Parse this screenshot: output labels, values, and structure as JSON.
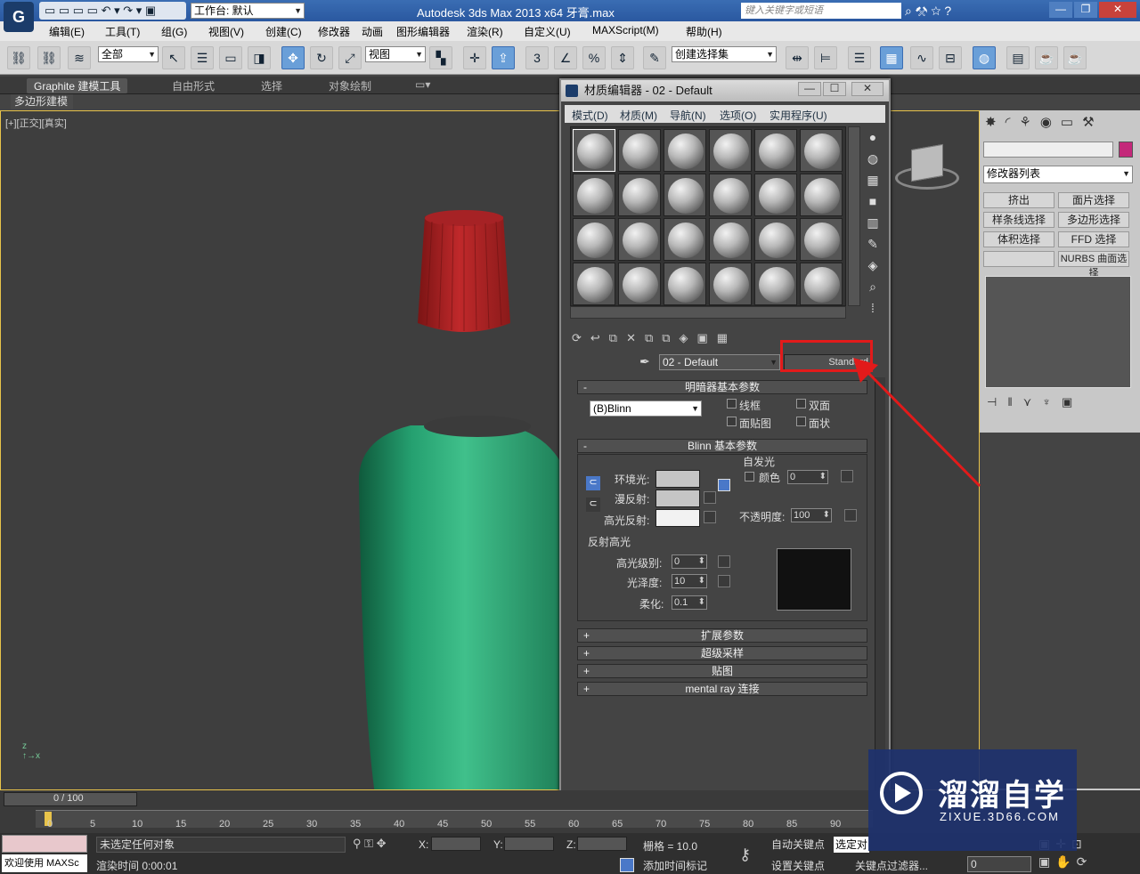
{
  "window": {
    "title": "Autodesk 3ds Max  2013 x64    牙膏.max",
    "workspace": "工作台: 默认",
    "search_placeholder": "键入关键字或短语"
  },
  "menu": [
    "编辑(E)",
    "工具(T)",
    "组(G)",
    "视图(V)",
    "创建(C)",
    "修改器",
    "动画",
    "图形编辑器",
    "渲染(R)",
    "自定义(U)",
    "MAXScript(M)",
    "帮助(H)"
  ],
  "toolbar": {
    "filter": "全部",
    "ref_coord": "视图",
    "selection_set": "创建选择集",
    "snap_3": "3",
    "snap_pct": "%"
  },
  "ribbon": {
    "tabs": [
      "Graphite 建模工具",
      "自由形式",
      "选择",
      "对象绘制"
    ],
    "sub": "多边形建模"
  },
  "viewport": {
    "label": "[+][正交][真实]"
  },
  "material_editor": {
    "title": "材质编辑器 - 02 - Default",
    "menu": [
      "模式(D)",
      "材质(M)",
      "导航(N)",
      "选项(O)",
      "实用程序(U)"
    ],
    "material_name": "02 - Default",
    "material_type": "Standard",
    "shader_rollout": "明暗器基本参数",
    "shader": "(B)Blinn",
    "options": [
      "线框",
      "双面",
      "面贴图",
      "面状"
    ],
    "blinn_rollout": "Blinn 基本参数",
    "self_illum_group": "自发光",
    "self_illum_color": "颜色",
    "self_illum_value": "0",
    "ambient": "环境光:",
    "diffuse": "漫反射:",
    "specular": "高光反射:",
    "opacity_label": "不透明度:",
    "opacity_value": "100",
    "spec_group": "反射高光",
    "spec_level_label": "高光级别:",
    "spec_level": "0",
    "gloss_label": "光泽度:",
    "gloss": "10",
    "soften_label": "柔化:",
    "soften": "0.1",
    "collapsed": [
      "扩展参数",
      "超级采样",
      "贴图",
      "mental ray 连接"
    ]
  },
  "cmd_panel": {
    "modifier_list": "修改器列表",
    "buttons": [
      "挤出",
      "面片选择",
      "样条线选择",
      "多边形选择",
      "体积选择",
      "FFD 选择",
      "",
      "NURBS 曲面选择"
    ]
  },
  "timeline": {
    "frame": "0 / 100",
    "ticks": [
      "0",
      "5",
      "10",
      "15",
      "20",
      "25",
      "30",
      "35",
      "40",
      "45",
      "50",
      "55",
      "60",
      "65",
      "70",
      "75",
      "80",
      "85",
      "90"
    ]
  },
  "status": {
    "selection": "未选定任何对象",
    "render_time": "渲染时间  0:00:01",
    "welcome": "欢迎使用 MAXSc",
    "x": "X:",
    "y": "Y:",
    "z": "Z:",
    "grid": "栅格 = 10.0",
    "auto_key": "自动关键点",
    "set_key": "设置关键点",
    "selected": "选定对",
    "key_filter": "关键点过滤器...",
    "add_tag": "添加时间标记",
    "frame_field": "0"
  },
  "watermark": {
    "brand": "溜溜自学",
    "url": "ZIXUE.3D66.COM"
  }
}
